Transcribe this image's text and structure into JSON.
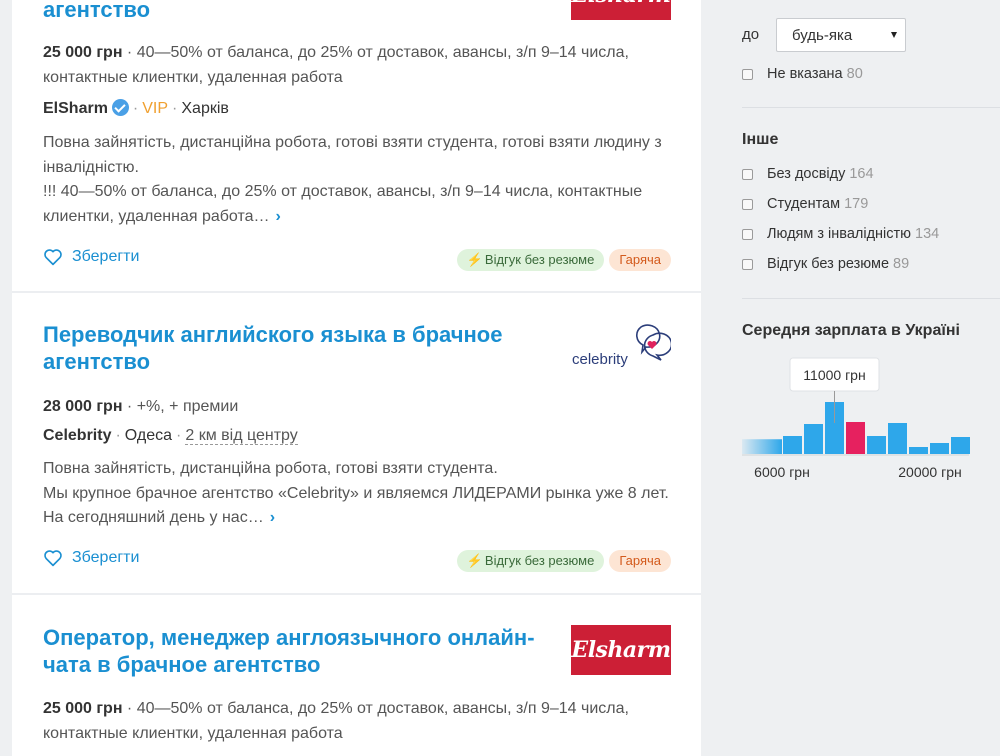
{
  "vacancies": [
    {
      "title": "агентство",
      "logo_text": "Elsharm",
      "salary": "25 000 грн",
      "salary_note": "40—50% от баланса, до 25% от доставок, авансы, з/п 9–14 числа, контактные клиентки, удаленная работа",
      "company": "ElSharm",
      "vip": "VIP",
      "city": "Харків",
      "desc_lines": [
        "Повна зайнятість, дистанційна робота, готові взяти студента, готові взяти людину з інвалідністю.",
        "!!! 40—50% от баланса, до 25% от доставок, авансы, з/п 9–14 числа, контактные клиентки, удаленная работа…"
      ],
      "save": "Зберегти",
      "badge_resume": "Відгук без резюме",
      "badge_hot": "Гаряча"
    },
    {
      "title": "Переводчик английского языка в брачное агентство",
      "logo_text": "celebrity",
      "salary": "28 000 грн",
      "salary_note": "+%, + премии",
      "company": "Celebrity",
      "city": "Одеса",
      "distance": "2 км від центру",
      "desc_lines": [
        "Повна зайнятість, дистанційна робота, готові взяти студента.",
        "Мы крупное брачное агентство «Celebrity» и являемся ЛИДЕРАМИ рынка уже 8 лет. На сегодняшний день у нас…"
      ],
      "save": "Зберегти",
      "badge_resume": "Відгук без резюме",
      "badge_hot": "Гаряча"
    },
    {
      "title": "Оператор, менеджер англоязычного онлайн-чата в брачное агентство",
      "logo_text": "Elsharm",
      "salary": "25 000 грн",
      "salary_note": "40—50% от баланса, до 25% от доставок, авансы, з/п 9–14 числа, контактные клиентки, удаленная работа"
    }
  ],
  "sidebar": {
    "salary_to_label": "до",
    "salary_to_value": "будь-яка",
    "not_specified": {
      "label": "Не вказана",
      "count": "80"
    },
    "other_title": "Інше",
    "other_items": [
      {
        "label": "Без досвіду",
        "count": "164"
      },
      {
        "label": "Студентам",
        "count": "179"
      },
      {
        "label": "Людям з інвалідністю",
        "count": "134"
      },
      {
        "label": "Відгук без резюме",
        "count": "89"
      }
    ],
    "avg_title": "Середня зарплата в Україні",
    "tooltip": "11000 грн",
    "axis_min_label": "6000 грн",
    "axis_max_label": "20000 грн"
  },
  "colors": {
    "link": "#1a8fd1",
    "bar": "#2ea7ea",
    "bar_highlight": "#e6215f",
    "brand_red": "#cc1f36",
    "hot_badge_bg": "#fde5d4",
    "resume_badge_bg": "#dff3dc"
  },
  "chart_data": {
    "type": "bar",
    "values": [
      18,
      30,
      52,
      32,
      18,
      31,
      7,
      11,
      17
    ],
    "highlight_index": 3
  }
}
